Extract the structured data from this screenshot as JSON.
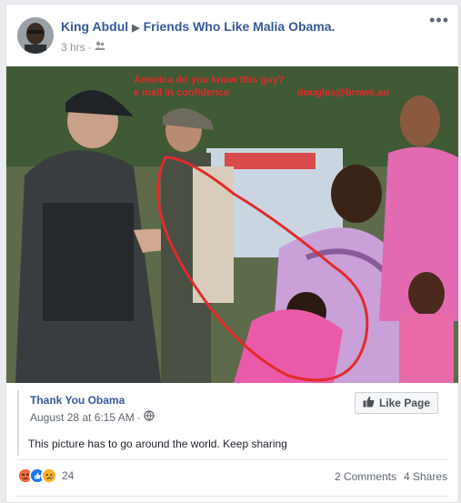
{
  "post": {
    "author": "King Abdul",
    "group": "Friends Who Like Malia Obama.",
    "time": "3 hrs",
    "privacy_icon": "friends-icon",
    "more_label": "•••"
  },
  "photo": {
    "overlay_lines": [
      "America do you know this guy?",
      "e mail in confidence",
      "douglas@brnws.au"
    ]
  },
  "card": {
    "title": "Thank You Obama",
    "date": "August 28 at 6:15 AM",
    "privacy_icon": "globe-icon",
    "like_page_label": "Like Page",
    "text": "This picture has to go around the world. Keep sharing"
  },
  "footer": {
    "reaction_icons": [
      "angry-icon",
      "like-icon",
      "sad-icon"
    ],
    "reaction_count": "24",
    "comments": "2 Comments",
    "shares": "4 Shares"
  },
  "colors": {
    "link": "#365899",
    "like": "#1877f2",
    "angry": "#e9710f",
    "sad": "#f7b125",
    "annotation": "#e22b2b"
  }
}
